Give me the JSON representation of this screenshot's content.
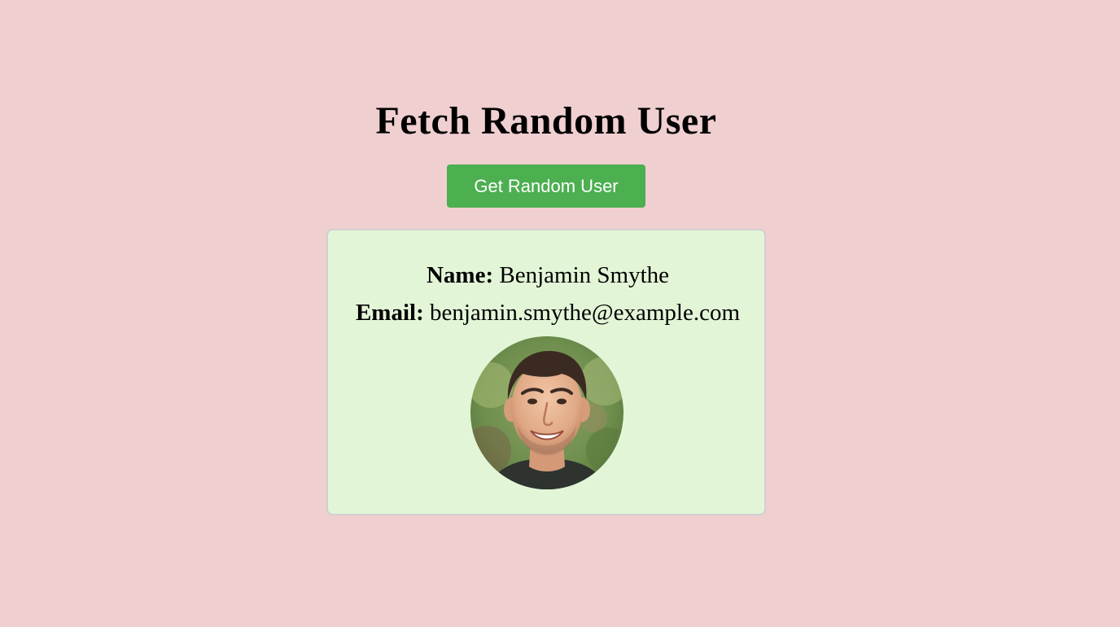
{
  "page": {
    "title": "Fetch Random User",
    "background_color": "#f0cfd0"
  },
  "actions": {
    "get_user_label": "Get Random User",
    "button_color": "#4caf50"
  },
  "user_card": {
    "name_label": "Name:",
    "name_value": "Benjamin Smythe",
    "email_label": "Email:",
    "email_value": "benjamin.smythe@example.com",
    "avatar_icon": "user-avatar-photo",
    "card_color": "#e3f5d7"
  }
}
